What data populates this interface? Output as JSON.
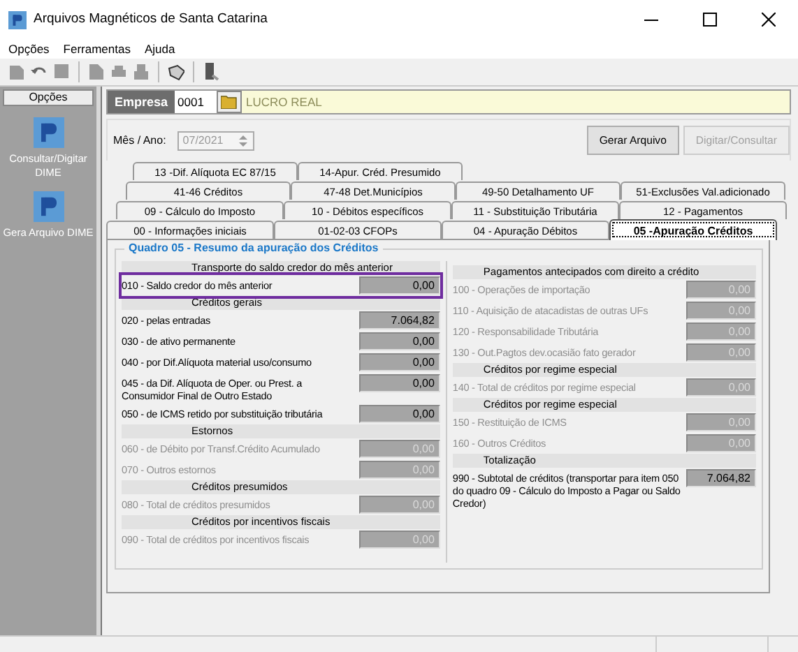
{
  "window": {
    "title": "Arquivos Magnéticos de Santa Catarina"
  },
  "menu": [
    "Opções",
    "Ferramentas",
    "Ajuda"
  ],
  "sidebar": {
    "title": "Opções",
    "items": [
      {
        "label": "Consultar/Digitar DIME"
      },
      {
        "label": "Gera Arquivo DIME"
      }
    ]
  },
  "empresa": {
    "label": "Empresa",
    "code": "0001",
    "name": "LUCRO REAL"
  },
  "period": {
    "label": "Mês / Ano:",
    "value": "07/2021",
    "disabled": true
  },
  "buttons": [
    {
      "label": "Gerar Arquivo",
      "disabled": false
    },
    {
      "label": "Digitar/Consultar",
      "disabled": true
    }
  ],
  "tab_rows": [
    [
      {
        "label": "13 -Dif. Alíquota EC 87/15",
        "selected": false
      },
      {
        "label": "14-Apur. Créd. Presumido",
        "selected": false
      }
    ],
    [
      {
        "label": "41-46   Créditos",
        "selected": false
      },
      {
        "label": "47-48  Det.Municípios",
        "selected": false
      },
      {
        "label": "49-50  Detalhamento UF",
        "selected": false
      },
      {
        "label": "51-Exclusões Val.adicionado",
        "selected": false
      }
    ],
    [
      {
        "label": "09 - Cálculo do Imposto",
        "selected": false
      },
      {
        "label": "10 - Débitos específicos",
        "selected": false
      },
      {
        "label": "11 -  Substituição Tributária",
        "selected": false
      },
      {
        "label": "12 - Pagamentos",
        "selected": false
      }
    ],
    [
      {
        "label": "00 - Informações iniciais",
        "selected": false
      },
      {
        "label": "01-02-03   CFOPs",
        "selected": false
      },
      {
        "label": "04 - Apuração Débitos",
        "selected": false
      },
      {
        "label": "05 -Apuração Créditos",
        "selected": true
      }
    ]
  ],
  "group_title": "Quadro 05 - Resumo da apuração dos Créditos",
  "columns": [
    [
      {
        "heading": "Transporte do saldo credor do mês anterior",
        "rows": [
          {
            "label": "010 - Saldo credor do mês anterior",
            "value": "0,00",
            "disabled": false,
            "highlighted": true
          }
        ]
      },
      {
        "heading": "Créditos gerais",
        "rows": [
          {
            "label": "020 - pelas entradas",
            "value": "7.064,82",
            "disabled": false,
            "highlighted": false
          },
          {
            "label": "030 - de ativo permanente",
            "value": "0,00",
            "disabled": false,
            "highlighted": false
          },
          {
            "label": "040 - por Dif.Alíquota material uso/consumo",
            "value": "0,00",
            "disabled": false,
            "highlighted": false
          },
          {
            "label": "045 - da Dif. Alíquota de Oper. ou Prest. a Consumidor Final de Outro Estado",
            "value": "0,00",
            "disabled": false,
            "highlighted": false
          },
          {
            "label": "050 - de ICMS retido por substituição tributária",
            "value": "0,00",
            "disabled": false,
            "highlighted": false
          }
        ]
      },
      {
        "heading": "Estornos",
        "rows": [
          {
            "label": "060 - de Débito por Transf.Crédito Acumulado",
            "value": "0,00",
            "disabled": true,
            "highlighted": false
          },
          {
            "label": "070 - Outros estornos",
            "value": "0,00",
            "disabled": true,
            "highlighted": false
          }
        ]
      },
      {
        "heading": "Créditos presumidos",
        "rows": [
          {
            "label": "080 - Total de créditos presumidos",
            "value": "0,00",
            "disabled": true,
            "highlighted": false
          }
        ]
      },
      {
        "heading": "Créditos por incentivos fiscais",
        "rows": [
          {
            "label": "090 - Total de créditos por incentivos fiscais",
            "value": "0,00",
            "disabled": true,
            "highlighted": false
          }
        ]
      }
    ],
    [
      {
        "heading": "Pagamentos antecipados com direito a crédito",
        "rows": [
          {
            "label": "100 - Operações de importação",
            "value": "0,00",
            "disabled": true,
            "highlighted": false
          },
          {
            "label": "110 - Aquisição de atacadistas de outras UFs",
            "value": "0,00",
            "disabled": true,
            "highlighted": false
          },
          {
            "label": "120 - Responsabilidade Tributária",
            "value": "0,00",
            "disabled": true,
            "highlighted": false
          },
          {
            "label": "130 - Out.Pagtos dev.ocasião fato gerador",
            "value": "0,00",
            "disabled": true,
            "highlighted": false
          }
        ]
      },
      {
        "heading": "Créditos por regime especial",
        "rows": [
          {
            "label": "140 - Total de créditos por regime especial",
            "value": "0,00",
            "disabled": true,
            "highlighted": false
          }
        ]
      },
      {
        "heading": "Créditos por regime especial",
        "rows": [
          {
            "label": "150 - Restituição de ICMS",
            "value": "0,00",
            "disabled": true,
            "highlighted": false
          },
          {
            "label": "160 - Outros Créditos",
            "value": "0,00",
            "disabled": true,
            "highlighted": false
          }
        ]
      },
      {
        "heading": "Totalização",
        "rows": [
          {
            "label": "990 - Subtotal de créditos  (transportar para item 050 do quadro 09 - Cálculo do Imposto a Pagar ou Saldo Credor)",
            "value": "7.064,82",
            "disabled": false,
            "highlighted": false
          }
        ]
      }
    ]
  ]
}
